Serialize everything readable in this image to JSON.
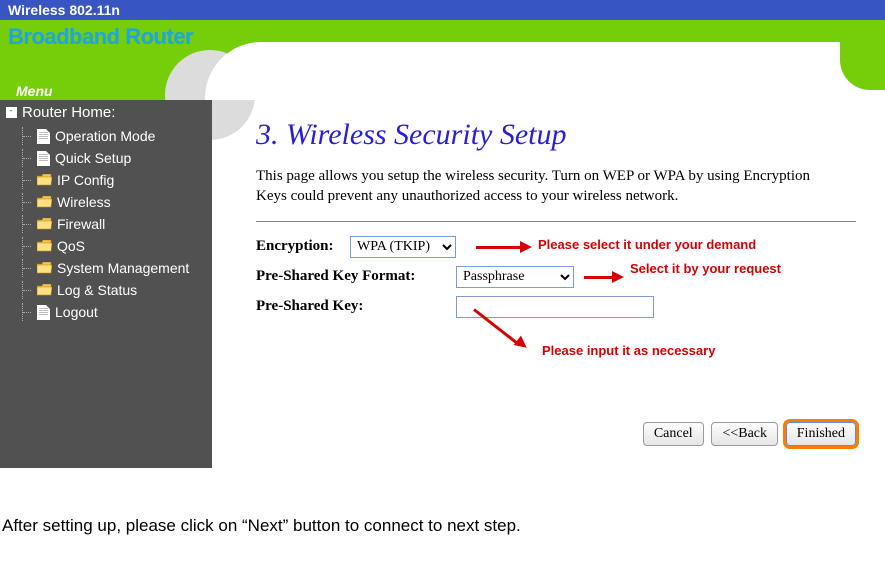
{
  "top_bar": {
    "title": "Wireless 802.11n"
  },
  "brand": "Broadband Router",
  "menu_tab": "Menu",
  "sidebar": {
    "home": "Router Home:",
    "items": [
      {
        "label": "Operation Mode",
        "icon": "page"
      },
      {
        "label": "Quick Setup",
        "icon": "page"
      },
      {
        "label": "IP Config",
        "icon": "folder"
      },
      {
        "label": "Wireless",
        "icon": "folder"
      },
      {
        "label": "Firewall",
        "icon": "folder"
      },
      {
        "label": "QoS",
        "icon": "folder"
      },
      {
        "label": "System Management",
        "icon": "folder"
      },
      {
        "label": "Log & Status",
        "icon": "folder"
      },
      {
        "label": "Logout",
        "icon": "page"
      }
    ]
  },
  "page": {
    "title": "3. Wireless Security Setup",
    "description": "This page allows you setup the wireless security. Turn on WEP or WPA by using Encryption Keys could prevent any unauthorized access to your wireless network."
  },
  "form": {
    "encryption_label": "Encryption:",
    "encryption_value": "WPA (TKIP)",
    "psk_format_label": "Pre-Shared Key Format:",
    "psk_format_value": "Passphrase",
    "psk_label": "Pre-Shared Key:",
    "psk_value": ""
  },
  "annotations": {
    "enc": "Please select it under your demand",
    "fmt": "Select it by your request",
    "psk": "Please input it as necessary"
  },
  "buttons": {
    "cancel": "Cancel",
    "back": "<<Back",
    "finished": "Finished"
  },
  "footer_note": "After setting up, please click on “Next” button to connect to next step."
}
